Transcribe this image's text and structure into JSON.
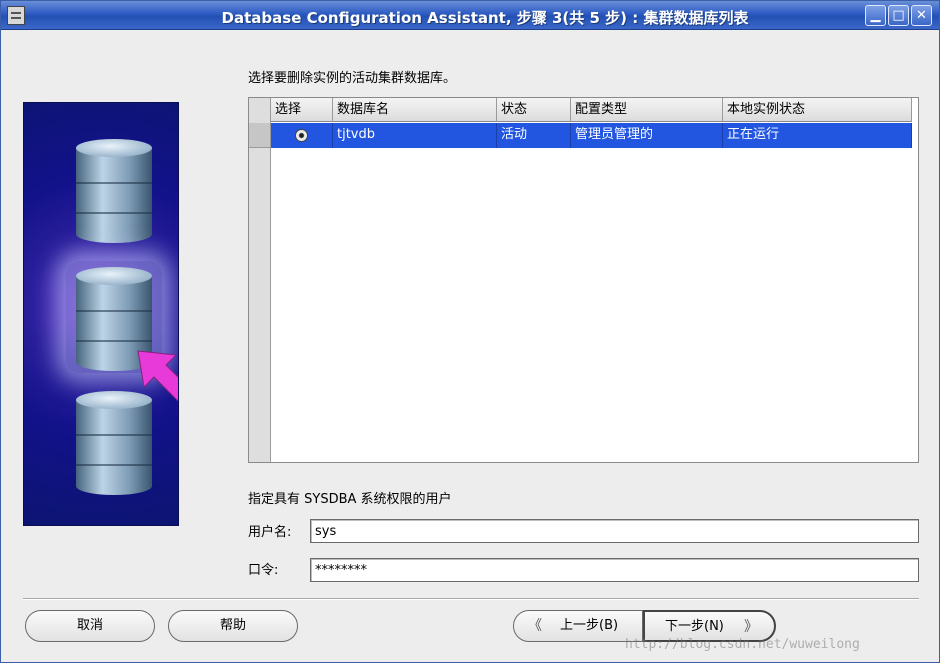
{
  "window": {
    "title": "Database Configuration Assistant, 步骤 3(共 5 步) : 集群数据库列表"
  },
  "main": {
    "instruction": "选择要删除实例的活动集群数据库。",
    "table": {
      "headers": [
        "选择",
        "数据库名",
        "状态",
        "配置类型",
        "本地实例状态"
      ],
      "rows": [
        {
          "database_name": "tjtvdb",
          "status": "活动",
          "config_type": "管理员管理的",
          "local_instance_status": "正在运行",
          "selected": true
        }
      ]
    },
    "credentials": {
      "section_label": "指定具有 SYSDBA 系统权限的用户",
      "username_label": "用户名:",
      "username_value": "sys",
      "password_label": "口令:",
      "password_value": "********"
    }
  },
  "footer": {
    "cancel_label": "取消",
    "help_label": "帮助",
    "back_label": "上一步(B)",
    "next_label": "下一步(N)",
    "watermark": "http://blog.csdn.net/wuweilong"
  },
  "colors": {
    "title_bar": "#2d5bc2",
    "selected_row": "#2255e0",
    "arrow": "#e83ad8"
  }
}
